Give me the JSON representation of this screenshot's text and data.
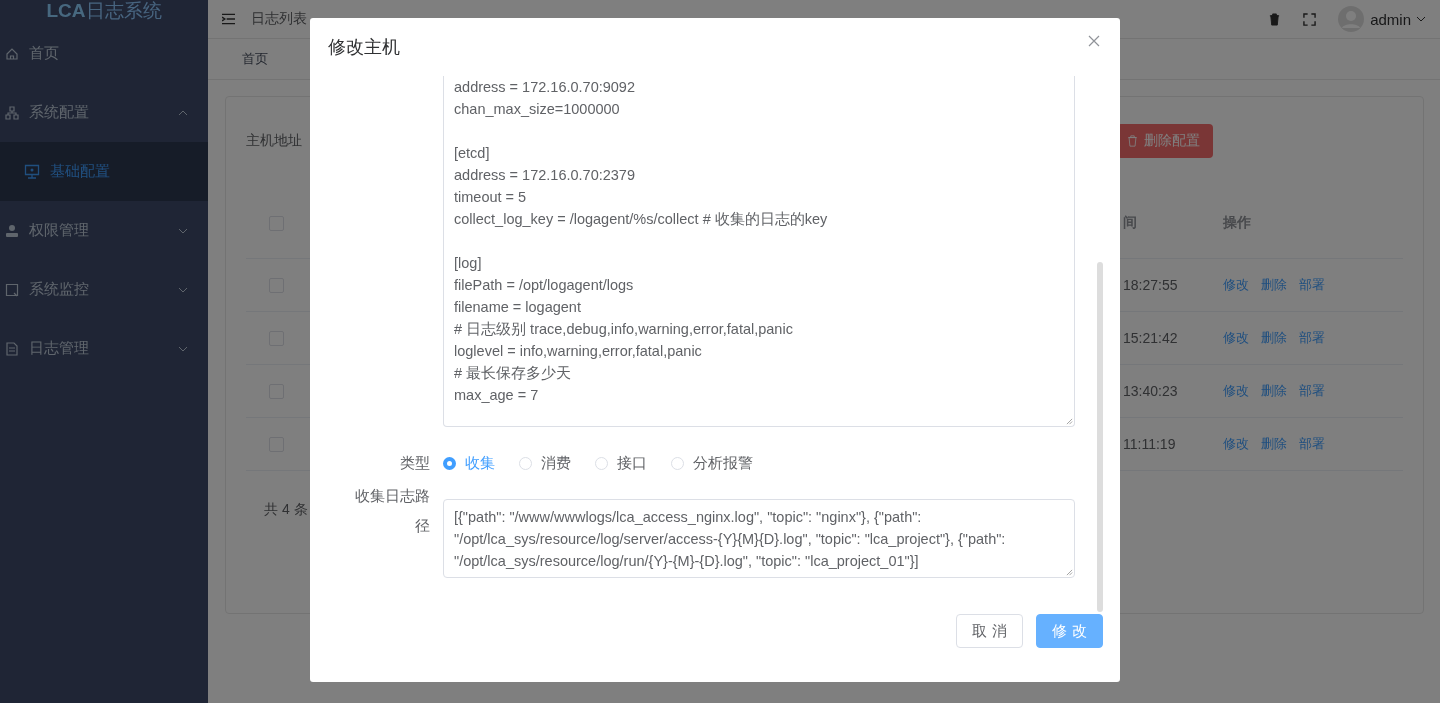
{
  "sidebar": {
    "logo": {
      "mark": "LCA",
      "text": "日志系统"
    },
    "items": [
      {
        "label": "首页",
        "selected": false
      },
      {
        "label": "系统配置",
        "selected": false,
        "expanded": true,
        "children": [
          {
            "label": "基础配置",
            "selected": true
          }
        ]
      },
      {
        "label": "权限管理",
        "selected": false,
        "expanded": false
      },
      {
        "label": "系统监控",
        "selected": false,
        "expanded": false
      },
      {
        "label": "日志管理",
        "selected": false,
        "expanded": false
      }
    ]
  },
  "header": {
    "breadcrumb": "日志列表",
    "user": "admin"
  },
  "tabs": [
    "首页"
  ],
  "card": {
    "filter_label": "主机地址",
    "delete_button": "删除配置",
    "table": {
      "columns": [
        "间",
        "操作"
      ],
      "header_checked": false,
      "rows": [
        {
          "checked": false,
          "time": "18:27:55",
          "actions": [
            "修改",
            "删除",
            "部署"
          ]
        },
        {
          "checked": false,
          "time": "15:21:42",
          "actions": [
            "修改",
            "删除",
            "部署"
          ]
        },
        {
          "checked": false,
          "time": "13:40:23",
          "actions": [
            "修改",
            "删除",
            "部署"
          ]
        },
        {
          "checked": false,
          "time": "11:11:19",
          "actions": [
            "修改",
            "删除",
            "部署"
          ]
        }
      ]
    },
    "total": "共 4 条"
  },
  "dialog": {
    "title": "修改主机",
    "config_blocks": [
      [
        "address = 172.16.0.70:9092",
        "chan_max_size=1000000"
      ],
      [
        "[etcd]",
        "address = 172.16.0.70:2379",
        "timeout = 5",
        "collect_log_key = /logagent/%s/collect # 收集的日志的key"
      ],
      [
        "[log]",
        "filePath = /opt/logagent/logs",
        "filename = logagent",
        "# 日志级别 trace,debug,info,warning,error,fatal,panic",
        "loglevel = info,warning,error,fatal,panic",
        "# 最长保存多少天",
        "max_age = 7"
      ]
    ],
    "type": {
      "label": "类型",
      "options": [
        {
          "label": "收集",
          "selected": true
        },
        {
          "label": "消费",
          "selected": false
        },
        {
          "label": "接口",
          "selected": false
        },
        {
          "label": "分析报警",
          "selected": false
        }
      ]
    },
    "path": {
      "label": "收集日志路径",
      "value": "[{\"path\": \"/www/wwwlogs/lca_access_nginx.log\", \"topic\": \"nginx\"}, {\"path\": \"/opt/lca_sys/resource/log/server/access-{Y}{M}{D}.log\", \"topic\": \"lca_project\"}, {\"path\": \"/opt/lca_sys/resource/log/run/{Y}-{M}-{D}.log\", \"topic\": \"lca_project_01\"}]"
    },
    "buttons": [
      {
        "label": "取 消",
        "kind": "default"
      },
      {
        "label": "修 改",
        "kind": "primary"
      }
    ]
  }
}
